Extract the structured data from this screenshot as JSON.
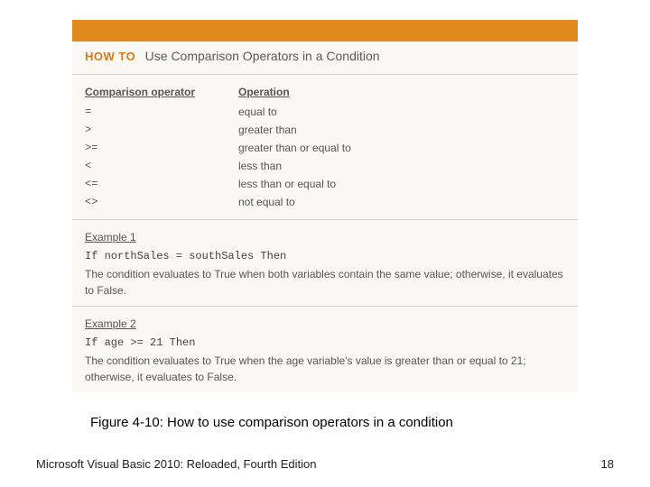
{
  "howto": {
    "label": "HOW TO",
    "title": "Use Comparison Operators in a Condition"
  },
  "table": {
    "head_op": "Comparison operator",
    "head_what": "Operation",
    "rows": [
      {
        "op": "=",
        "what": "equal to"
      },
      {
        "op": ">",
        "what": "greater than"
      },
      {
        "op": ">=",
        "what": "greater than or equal to"
      },
      {
        "op": "<",
        "what": "less than"
      },
      {
        "op": "<=",
        "what": "less than or equal to"
      },
      {
        "op": "<>",
        "what": "not equal to"
      }
    ]
  },
  "example1": {
    "label": "Example 1",
    "code": "If northSales = southSales Then",
    "desc": "The condition evaluates to True when both variables contain the same value; otherwise, it evaluates to False."
  },
  "example2": {
    "label": "Example 2",
    "code": "If age >= 21 Then",
    "desc": "The condition evaluates to True when the age variable's value is greater than or equal to 21; otherwise, it evaluates to False."
  },
  "caption": "Figure 4-10: How to use comparison operators in a condition",
  "footer": {
    "book": "Microsoft Visual Basic 2010: Reloaded, Fourth Edition",
    "page": "18"
  }
}
